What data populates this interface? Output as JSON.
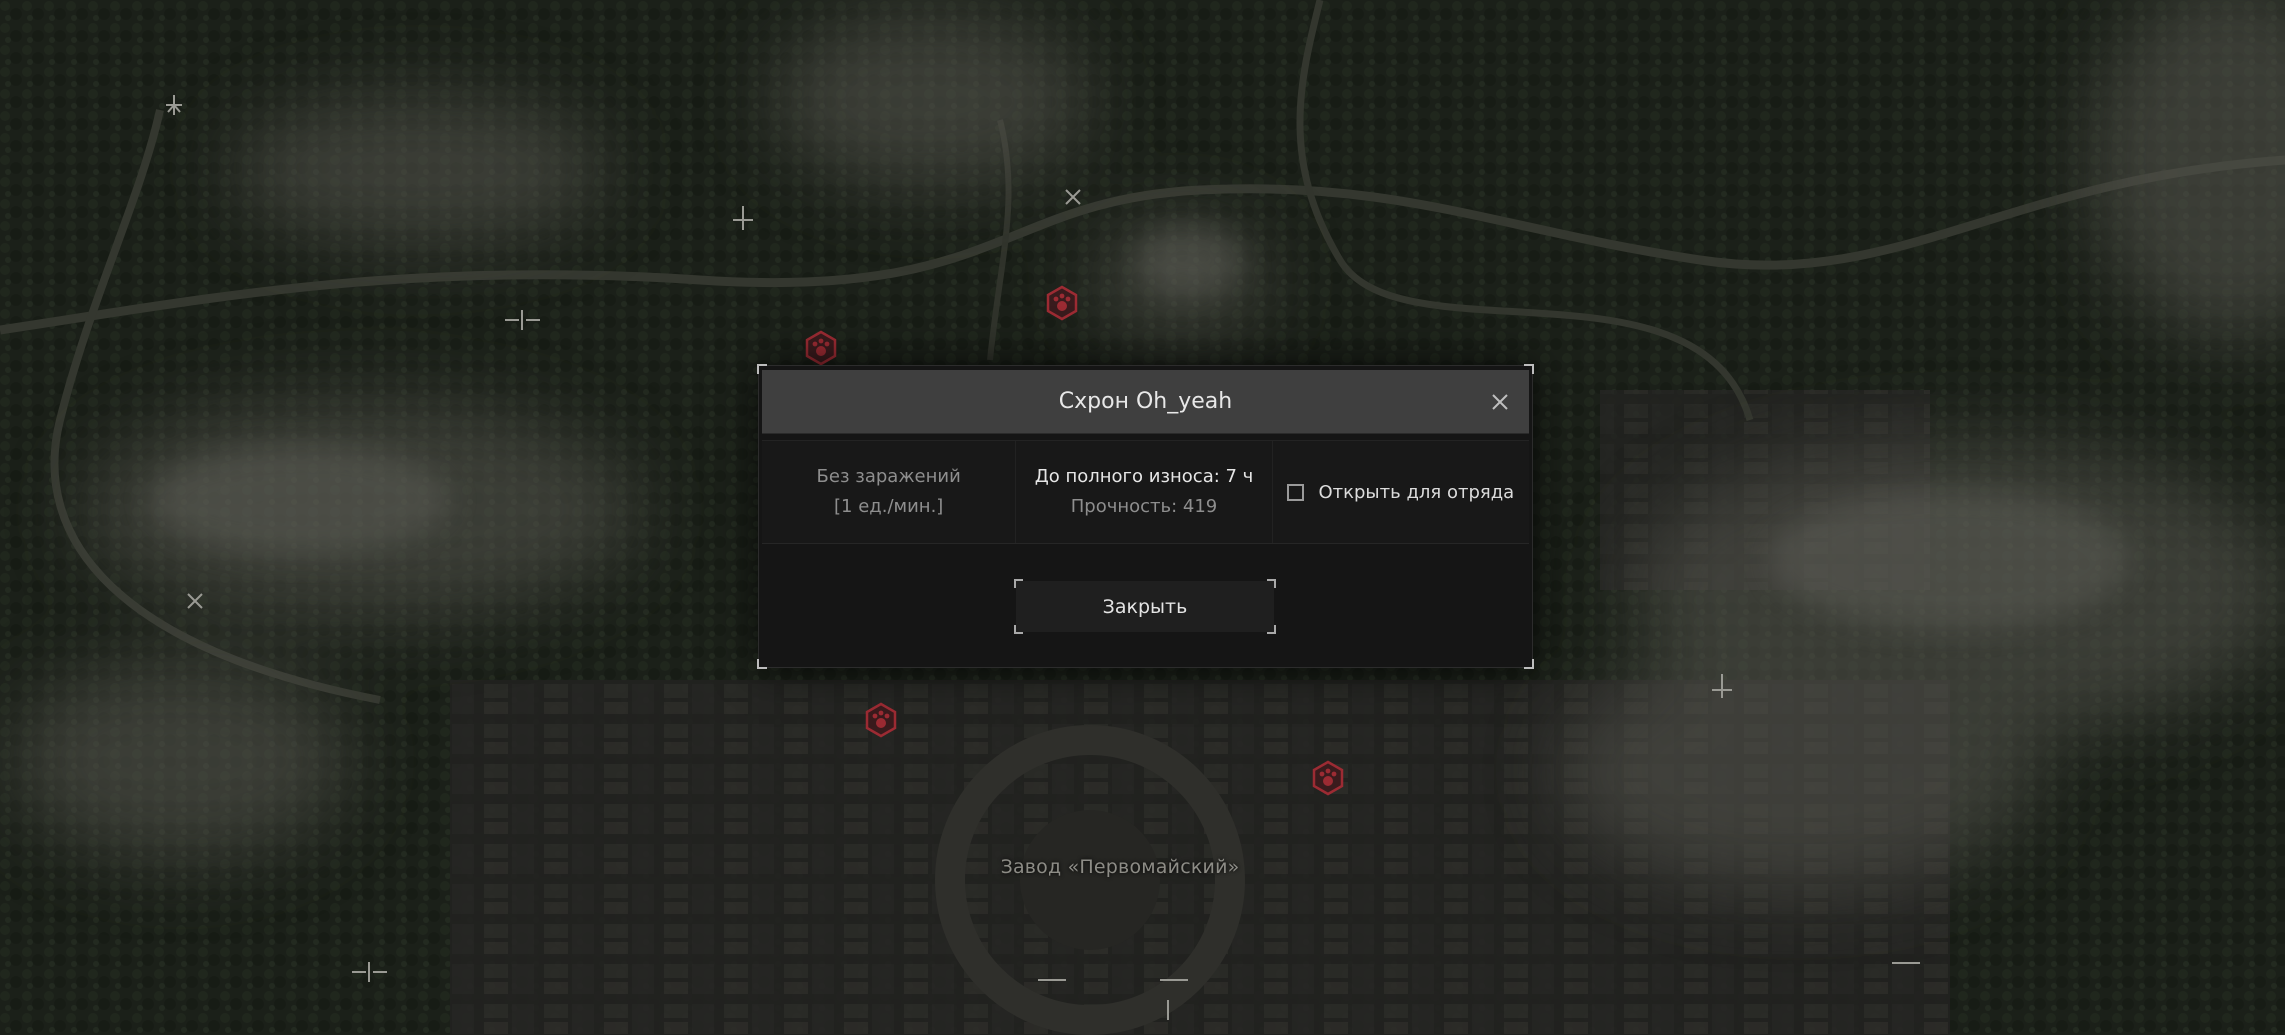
{
  "map": {
    "location_label": "Завод «Первомайский»",
    "markers": [
      {
        "icon": "paw-icon"
      },
      {
        "icon": "paw-icon"
      },
      {
        "icon": "paw-icon"
      },
      {
        "icon": "paw-icon"
      }
    ],
    "accent_color": "#9c2b33"
  },
  "dialog": {
    "title": "Схрон Oh_yeah",
    "contamination": {
      "label": "Без заражений",
      "rate": "[1 ед./мин.]"
    },
    "wear": {
      "time_label": "До полного износа: 7 ч",
      "durability_label": "Прочность: 419"
    },
    "squad_option": {
      "label": "Открыть для отряда",
      "checked": false
    },
    "close_button_label": "Закрыть",
    "close_icon": "close-icon"
  }
}
